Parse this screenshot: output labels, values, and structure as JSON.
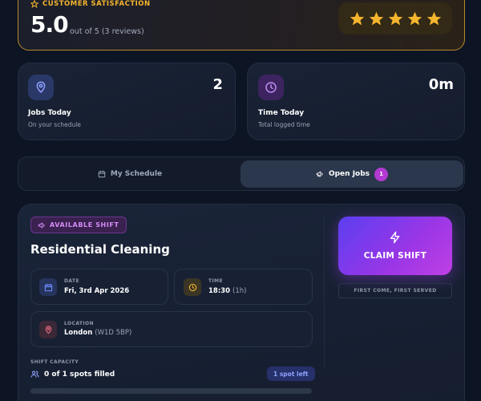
{
  "satisfaction": {
    "label": "CUSTOMER SATISFACTION",
    "score": "5.0",
    "subtext": "out of 5 (3 reviews)",
    "stars": 5,
    "star_color": "#f5b52e"
  },
  "stats": [
    {
      "title": "Jobs Today",
      "subtitle": "On your schedule",
      "value": "2",
      "icon": "map-pin-icon",
      "icon_color": "#8fa3ff"
    },
    {
      "title": "Time Today",
      "subtitle": "Total logged time",
      "value": "0m",
      "icon": "clock-icon",
      "icon_color": "#c08cf5"
    }
  ],
  "tabs": {
    "schedule_label": "My Schedule",
    "open_jobs_label": "Open Jobs",
    "open_jobs_count": "1"
  },
  "shift": {
    "badge": "AVAILABLE SHIFT",
    "title": "Residential Cleaning",
    "date_label": "DATE",
    "date_value": "Fri, 3rd Apr 2026",
    "time_label": "TIME",
    "time_value": "18:30",
    "time_duration": "(1h)",
    "location_label": "LOCATION",
    "location_value": "London",
    "location_postcode": "(W1D 5BP)",
    "claim_label": "CLAIM SHIFT",
    "fcfs_label": "FIRST COME, FIRST SERVED",
    "capacity_label": "SHIFT CAPACITY",
    "capacity_text": "0 of 1 spots filled",
    "spots_left": "1 spot left",
    "capacity_fill": 0
  },
  "colors": {
    "accent_purple": "#9b36e6",
    "accent_gold": "#f5b52e",
    "background": "#0d1424"
  }
}
